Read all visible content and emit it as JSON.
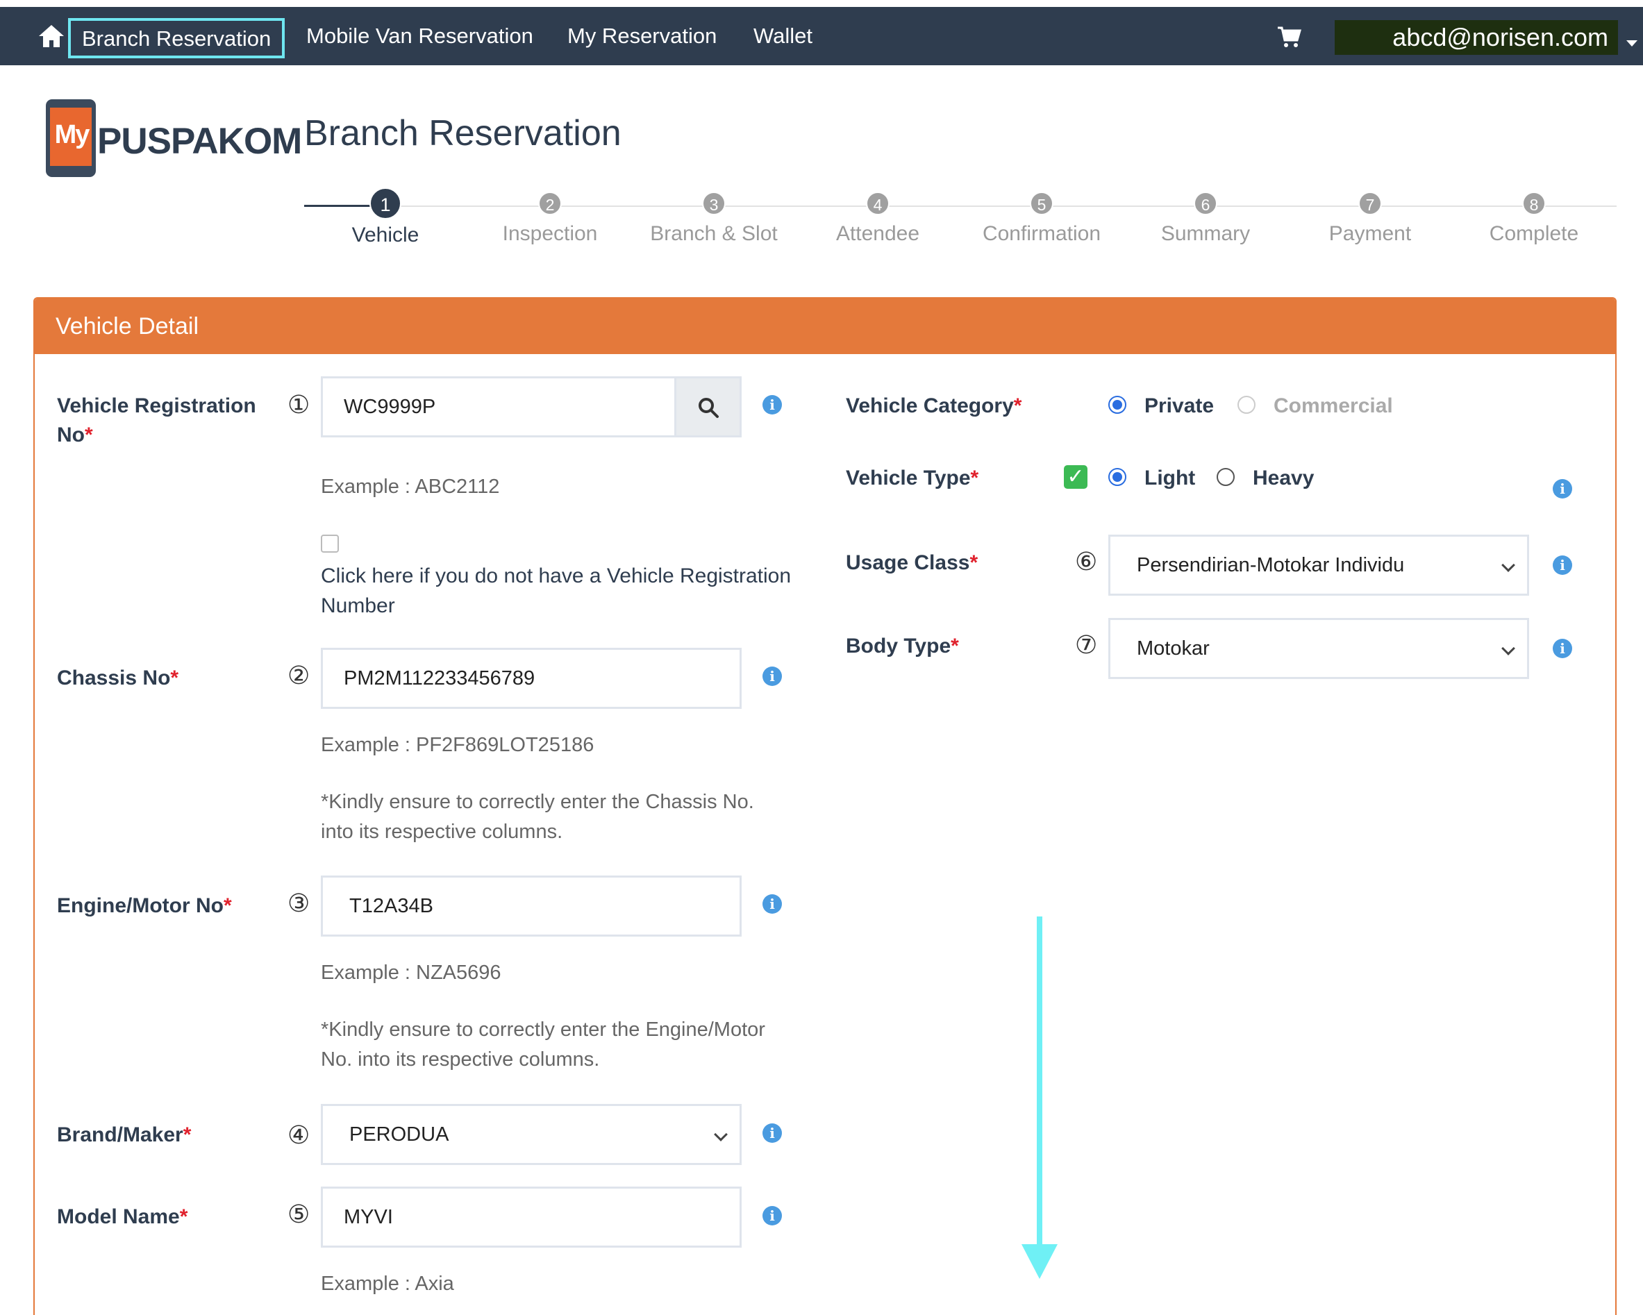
{
  "nav": {
    "items": [
      {
        "label": "Branch Reservation",
        "active": true
      },
      {
        "label": "Mobile Van Reservation"
      },
      {
        "label": "My Reservation"
      },
      {
        "label": "Wallet"
      }
    ],
    "user_email": "abcd@norisen.com",
    "icons": {
      "home": "home-icon",
      "cart": "cart-icon",
      "caret": "caret-down-icon"
    }
  },
  "header": {
    "logo_my": "My",
    "logo_text": "PUSPAKOM",
    "title": "Branch Reservation"
  },
  "stepper": {
    "steps": [
      {
        "num": "1",
        "label": "Vehicle",
        "active": true
      },
      {
        "num": "2",
        "label": "Inspection"
      },
      {
        "num": "3",
        "label": "Branch & Slot"
      },
      {
        "num": "4",
        "label": "Attendee"
      },
      {
        "num": "5",
        "label": "Confirmation"
      },
      {
        "num": "6",
        "label": "Summary"
      },
      {
        "num": "7",
        "label": "Payment"
      },
      {
        "num": "8",
        "label": "Complete"
      }
    ]
  },
  "panel": {
    "title": "Vehicle Detail",
    "required_mark": "*",
    "left": {
      "reg": {
        "label_line1": "Vehicle Registration",
        "label_line2": "No",
        "marker": "①",
        "value": "WC9999P",
        "example": "Example : ABC2112"
      },
      "no_reg_checkbox": {
        "line1": "Click here if you do not have a Vehicle Registration",
        "line2": "Number",
        "checked": false
      },
      "chassis": {
        "label": "Chassis No",
        "marker": "②",
        "value": "PM2M112233456789",
        "example": "Example : PF2F869LOT25186",
        "note_line1": "*Kindly ensure to correctly enter the Chassis No.",
        "note_line2": "into its respective columns."
      },
      "engine": {
        "label": "Engine/Motor No",
        "marker": "③",
        "value": "T12A34B",
        "example": "Example : NZA5696",
        "note_line1": "*Kindly ensure to correctly enter the Engine/Motor",
        "note_line2": "No. into its respective columns."
      },
      "brand": {
        "label": "Brand/Maker",
        "marker": "④",
        "value": "PERODUA"
      },
      "model": {
        "label": "Model Name",
        "marker": "⑤",
        "value": "MYVI",
        "example": "Example : Axia"
      }
    },
    "right": {
      "category": {
        "label": "Vehicle Category",
        "options": [
          "Private",
          "Commercial"
        ],
        "selected": "Private"
      },
      "type": {
        "label": "Vehicle Type",
        "check_mark": "✓",
        "options": [
          "Light",
          "Heavy"
        ],
        "selected": "Light"
      },
      "usage": {
        "label": "Usage Class",
        "marker": "⑥",
        "value": "Persendirian-Motokar Individu"
      },
      "body": {
        "label": "Body Type",
        "marker": "⑦",
        "value": "Motokar"
      }
    },
    "info_glyph": "i"
  },
  "colors": {
    "navbar": "#2f3d4f",
    "accent": "#e4793b",
    "active_highlight": "#6fe6f0",
    "arrow": "#6ff0f5",
    "required": "#e0222d",
    "radio": "#2a6de0"
  }
}
